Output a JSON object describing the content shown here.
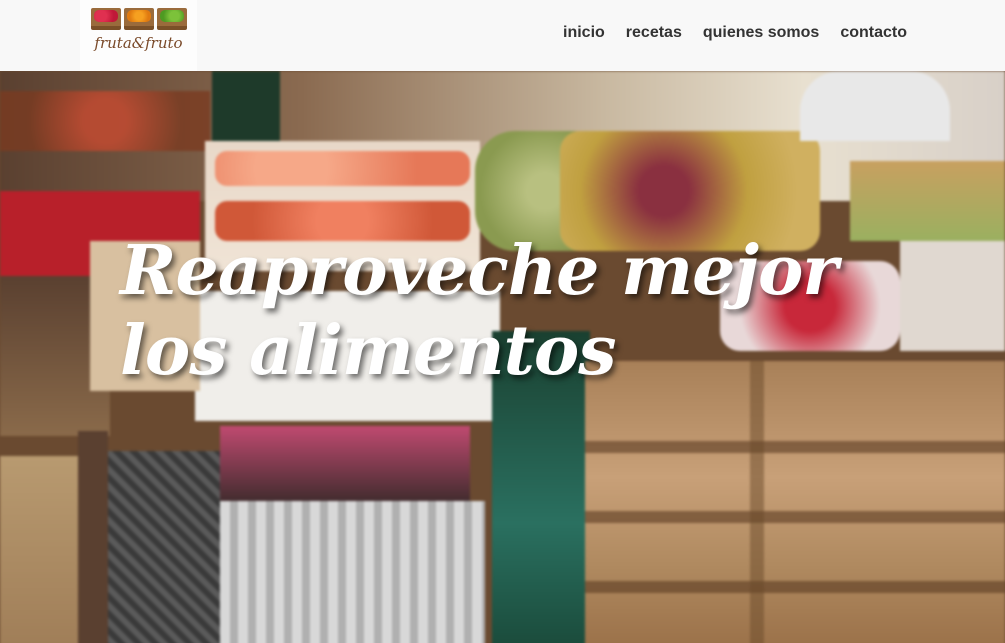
{
  "site": {
    "logo_text": "fruta&fruto",
    "logo_icon": "fruit-crates-logo"
  },
  "nav": {
    "items": [
      {
        "label": "inicio"
      },
      {
        "label": "recetas"
      },
      {
        "label": "quienes somos"
      },
      {
        "label": "contacto"
      }
    ]
  },
  "hero": {
    "title": "Reaproveche mejor los alimentos",
    "background": "market-fruit-stand-photo"
  },
  "colors": {
    "header_bg": "#f8f8f8",
    "nav_text": "#333333",
    "title_text": "#ffffff"
  }
}
